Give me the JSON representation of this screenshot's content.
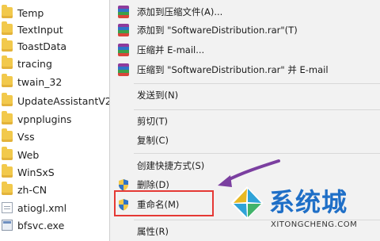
{
  "files": [
    {
      "name": "Temp",
      "icon": "folder-icon"
    },
    {
      "name": "TextInput",
      "icon": "folder-icon"
    },
    {
      "name": "ToastData",
      "icon": "folder-icon"
    },
    {
      "name": "tracing",
      "icon": "folder-icon"
    },
    {
      "name": "twain_32",
      "icon": "folder-icon"
    },
    {
      "name": "UpdateAssistantV2",
      "icon": "folder-icon"
    },
    {
      "name": "vpnplugins",
      "icon": "folder-icon"
    },
    {
      "name": "Vss",
      "icon": "folder-icon"
    },
    {
      "name": "Web",
      "icon": "folder-icon"
    },
    {
      "name": "WinSxS",
      "icon": "folder-icon"
    },
    {
      "name": "zh-CN",
      "icon": "folder-icon"
    },
    {
      "name": "atiogl.xml",
      "icon": "xml-file-icon"
    },
    {
      "name": "bfsvc.exe",
      "icon": "exe-file-icon"
    }
  ],
  "context_menu": {
    "items": [
      {
        "id": "add-to-archive",
        "label": "添加到压缩文件(A)...",
        "icon": "winrar-icon"
      },
      {
        "id": "add-to-rar",
        "label": "添加到 \"SoftwareDistribution.rar\"(T)",
        "icon": "winrar-icon"
      },
      {
        "id": "compress-email",
        "label": "压缩并 E-mail...",
        "icon": "winrar-icon"
      },
      {
        "id": "compress-rar-email",
        "label": "压缩到 \"SoftwareDistribution.rar\" 并 E-mail",
        "icon": "winrar-icon"
      },
      {
        "id": "send-to",
        "label": "发送到(N)",
        "icon": ""
      },
      {
        "id": "cut",
        "label": "剪切(T)",
        "icon": ""
      },
      {
        "id": "copy",
        "label": "复制(C)",
        "icon": ""
      },
      {
        "id": "create-shortcut",
        "label": "创建快捷方式(S)",
        "icon": ""
      },
      {
        "id": "delete",
        "label": "删除(D)",
        "icon": "uac-shield-icon"
      },
      {
        "id": "rename",
        "label": "重命名(M)",
        "icon": "uac-shield-icon"
      },
      {
        "id": "properties",
        "label": "属性(R)",
        "icon": ""
      }
    ]
  },
  "watermark": {
    "title": "系统城",
    "url": "XITONGCHENG.COM"
  },
  "colors": {
    "highlight_border": "#e53935",
    "arrow": "#7b3fa0",
    "watermark_blue": "#1f6fc7"
  }
}
